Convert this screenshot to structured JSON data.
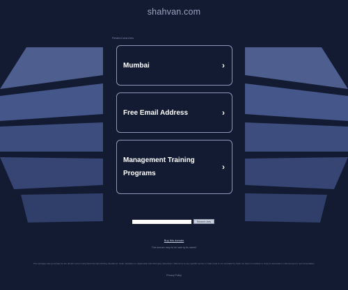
{
  "site": {
    "domain": "shahvan.com"
  },
  "related": {
    "label": "Related searches",
    "links": [
      {
        "label": "Mumbai"
      },
      {
        "label": "Free Email Address"
      },
      {
        "label": "Management Training Programs"
      }
    ]
  },
  "search": {
    "placeholder": "",
    "button_label": "Search Ads"
  },
  "footer": {
    "buy_link": "Buy this domain",
    "owner_note": "This domain may be for sale by its owner!",
    "disclaimer": "This webpage was generated by the domain owner using Sedo Domain Parking. Disclaimer: Sedo maintains no relationship with third party advertisers. Reference to any specific service or trade mark is not controlled by Sedo nor does it constitute or imply its association, endorsement or recommendation.",
    "privacy": "Privacy Policy"
  },
  "icons": {
    "chevron": "chevron-right-icon"
  },
  "colors": {
    "background": "#131b33",
    "card_border": "#8e98b8",
    "deco": "#4d5d8c"
  }
}
